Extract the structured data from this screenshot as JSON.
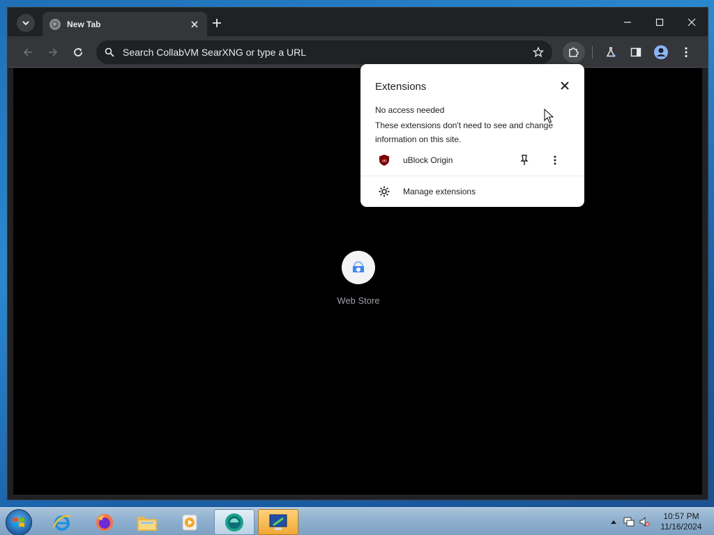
{
  "tab": {
    "title": "New Tab"
  },
  "omnibox": {
    "placeholder": "Search CollabVM SearXNG or type a URL"
  },
  "shortcut": {
    "label": "Web Store"
  },
  "extensions_popup": {
    "title": "Extensions",
    "section_heading": "No access needed",
    "section_description": "These extensions don't need to see and change information on this site.",
    "items": [
      {
        "name": "uBlock Origin"
      }
    ],
    "manage_label": "Manage extensions"
  },
  "taskbar": {
    "clock_time": "10:57 PM",
    "clock_date": "11/16/2024"
  },
  "icons": {
    "tab_search": "chevron-down-icon",
    "new_tab": "plus-icon",
    "back": "arrow-left-icon",
    "forward": "arrow-right-icon",
    "reload": "reload-icon",
    "search": "search-icon",
    "bookmark": "star-icon",
    "extensions": "puzzle-icon",
    "labs": "flask-icon",
    "side_panel": "side-panel-icon",
    "profile": "profile-icon",
    "menu": "more-vertical-icon"
  },
  "colors": {
    "chrome_frame": "#202124",
    "toolbar": "#35363a",
    "content_bg": "#000000",
    "popup_bg": "#ffffff",
    "ublock_red": "#800000"
  }
}
